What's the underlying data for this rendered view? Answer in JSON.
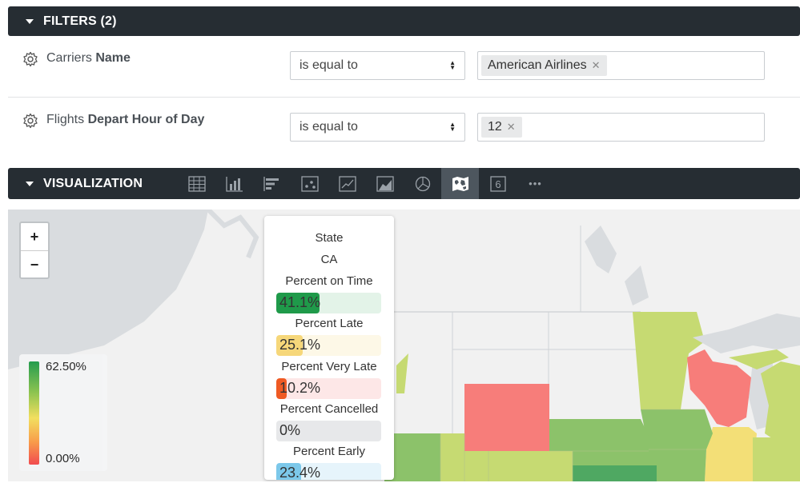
{
  "filters": {
    "title": "FILTERS (2)",
    "rows": [
      {
        "label_light": "Carriers ",
        "label_bold": "Name",
        "operator": "is equal to",
        "value": "American Airlines"
      },
      {
        "label_light": "Flights ",
        "label_bold": "Depart Hour of Day",
        "operator": "is equal to",
        "value": "12"
      }
    ]
  },
  "visualization": {
    "title": "VISUALIZATION",
    "icons": [
      "table-icon",
      "column-chart-icon",
      "bar-chart-icon",
      "scatter-icon",
      "line-chart-icon",
      "area-chart-icon",
      "pie-chart-icon",
      "map-icon",
      "single-value-icon",
      "more-icon"
    ],
    "single_value_glyph": "6",
    "more_glyph": "•••",
    "active": "map-icon"
  },
  "map": {
    "zoom_in": "+",
    "zoom_out": "−",
    "legend": {
      "max": "62.50%",
      "min": "0.00%"
    },
    "tooltip": {
      "state_label": "State",
      "state_value": "CA",
      "metrics": [
        {
          "label": "Percent on Time",
          "value": "41.1%",
          "fraction": 0.411,
          "bar_color": "#1f9a4a",
          "track_color": "#e3f3e8"
        },
        {
          "label": "Percent Late",
          "value": "25.1%",
          "fraction": 0.251,
          "bar_color": "#f6d77a",
          "track_color": "#fdf8e7"
        },
        {
          "label": "Percent Very Late",
          "value": "10.2%",
          "fraction": 0.102,
          "bar_color": "#ef5a23",
          "track_color": "#fde7e7"
        },
        {
          "label": "Percent Cancelled",
          "value": "0%",
          "fraction": 0.0,
          "bar_color": "#9aa0a6",
          "track_color": "#e7e8ea"
        },
        {
          "label": "Percent Early",
          "value": "23.4%",
          "fraction": 0.234,
          "bar_color": "#7cc8ea",
          "track_color": "#e6f4fb"
        }
      ]
    },
    "colors": {
      "red_state": "#f77d7a",
      "green": "#8cc26a",
      "light_green": "#c6da72",
      "yellow": "#f3df77",
      "water": "#d9dcdf",
      "land": "#f1f1f1"
    }
  }
}
